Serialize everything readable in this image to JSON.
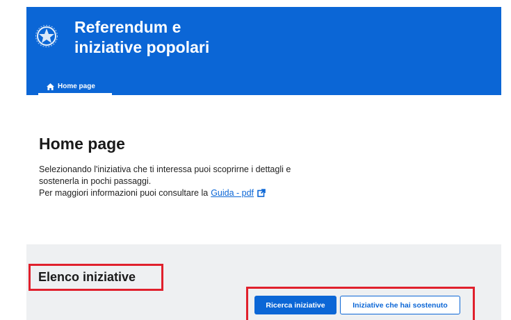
{
  "header": {
    "app_title": "Referendum e\niniziative popolari",
    "emblem_icon": "italian-republic-emblem-icon",
    "brand_color": "#0b66d6",
    "nav": {
      "home_tab_label": "Home page",
      "home_icon": "home-icon"
    }
  },
  "main": {
    "page_title": "Home page",
    "intro_line1": "Selezionando l'iniziativa che ti interessa puoi scoprirne i dettagli e",
    "intro_line2": "sostenerla in pochi passaggi.",
    "intro_line3_prefix": "Per maggiori informazioni puoi consultare la",
    "guide_link": "Guida - pdf",
    "external_link_icon": "external-link-icon"
  },
  "section": {
    "title": "Elenco iniziative",
    "buttons": {
      "search_label": "Ricerca iniziative",
      "supported_label": "Iniziative che hai sostenuto"
    },
    "highlight_color": "#e0202c"
  }
}
